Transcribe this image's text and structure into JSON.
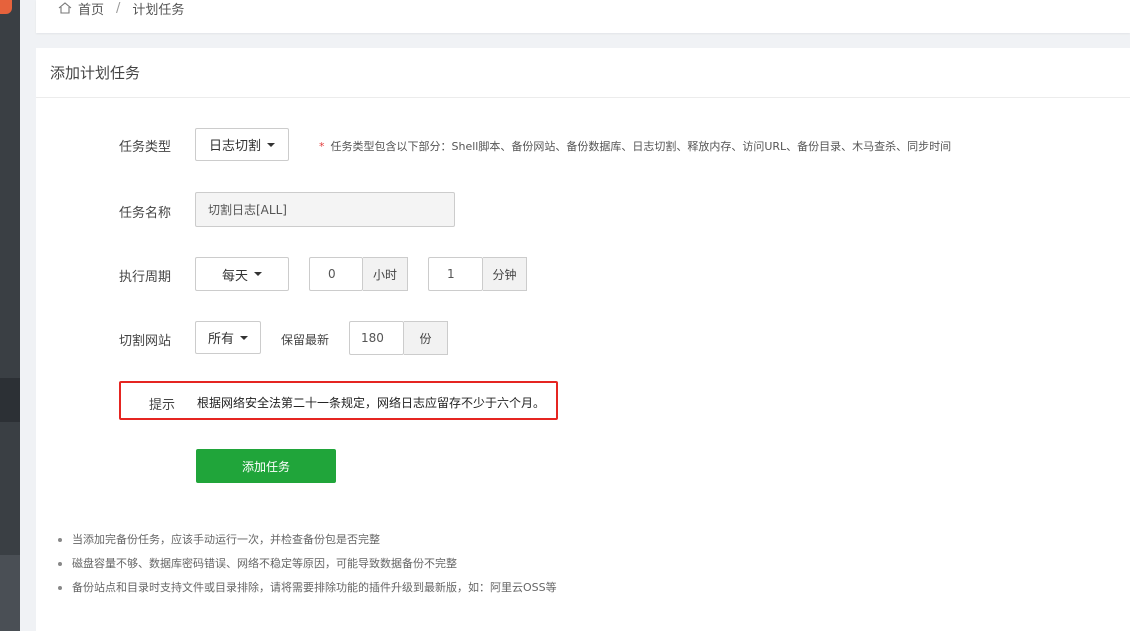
{
  "breadcrumb": {
    "home_icon": "home-icon",
    "home": "首页",
    "separator": "/",
    "current": "计划任务"
  },
  "panel": {
    "title": "添加计划任务"
  },
  "form": {
    "task_type": {
      "label": "任务类型",
      "selected": "日志切割",
      "hint_star": "*",
      "hint": "任务类型包含以下部分：Shell脚本、备份网站、备份数据库、日志切割、释放内存、访问URL、备份目录、木马查杀、同步时间"
    },
    "task_name": {
      "label": "任务名称",
      "value": "切割日志[ALL]"
    },
    "period": {
      "label": "执行周期",
      "selected": "每天",
      "hour_value": "0",
      "hour_unit": "小时",
      "minute_value": "1",
      "minute_unit": "分钟"
    },
    "site": {
      "label": "切割网站",
      "selected": "所有",
      "keep_label": "保留最新",
      "keep_value": "180",
      "keep_unit": "份"
    },
    "notice": {
      "label": "提示",
      "text": "根据网络安全法第二十一条规定，网络日志应留存不少于六个月。",
      "border_color": "#e52521"
    },
    "submit_label": "添加任务",
    "submit_color": "#20a53a"
  },
  "tips": [
    "当添加完备份任务，应该手动运行一次，并检查备份包是否完整",
    "磁盘容量不够、数据库密码错误、网络不稳定等原因，可能导致数据备份不完整",
    "备份站点和目录时支持文件或目录排除，请将需要排除功能的插件升级到最新版，如：阿里云OSS等"
  ]
}
